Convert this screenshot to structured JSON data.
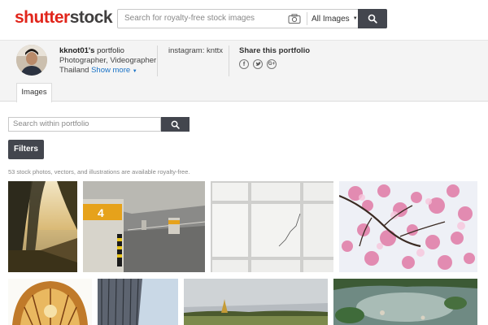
{
  "header": {
    "logo_part1": "shutter",
    "logo_part2": "stock",
    "search_placeholder": "Search for royalty-free stock images",
    "category": "All Images"
  },
  "profile": {
    "username": "kknot01's",
    "portfolio_suffix": " portfolio",
    "occupation": "Photographer, Videographer",
    "location": "Thailand",
    "show_more": "Show more",
    "instagram": "instagram: knttx",
    "share_heading": "Share this portfolio"
  },
  "tabs": [
    {
      "label": "Images"
    }
  ],
  "portfolio_search": {
    "placeholder": "Search within portfolio"
  },
  "filters_label": "Filters",
  "result_count": "53 stock photos, vectors, and illustrations are available royalty-free.",
  "icons": {
    "camera": "camera-icon",
    "search": "search-icon",
    "facebook": "facebook-icon",
    "twitter": "twitter-icon",
    "google_plus": "google-plus-icon"
  },
  "colors": {
    "brand_red": "#e1251b",
    "brand_dark": "#403e3e",
    "button_dark": "#43464e",
    "link_blue": "#1a73c7"
  }
}
